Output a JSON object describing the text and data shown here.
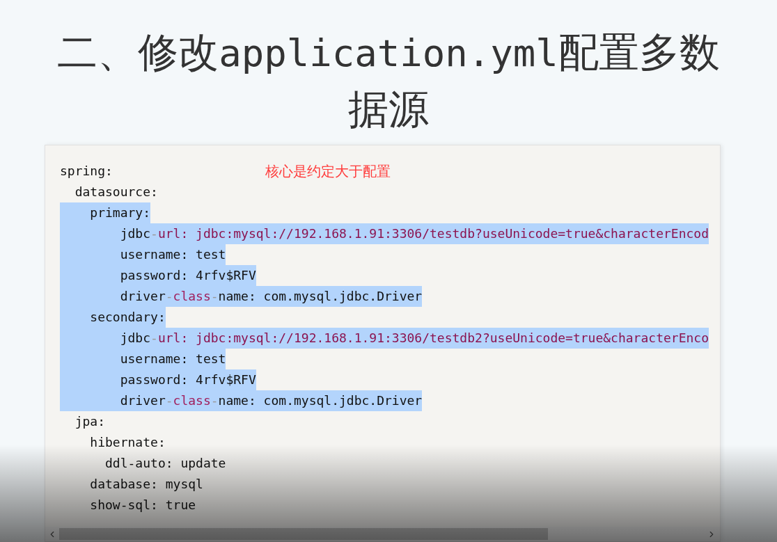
{
  "title": {
    "parts": [
      {
        "kind": "text",
        "text": "二、修改"
      },
      {
        "kind": "code",
        "text": "application.yml"
      },
      {
        "kind": "text",
        "text": "配置多数据源"
      }
    ]
  },
  "code_block": {
    "note": "核心是约定大于配置",
    "lines": [
      {
        "selected": false,
        "tokens": [
          {
            "kind": "plain",
            "text": "spring:"
          }
        ]
      },
      {
        "selected": false,
        "tokens": [
          {
            "kind": "plain",
            "text": "  datasource:"
          }
        ]
      },
      {
        "selected": true,
        "tokens": [
          {
            "kind": "plain",
            "text": "    primary:"
          }
        ]
      },
      {
        "selected": true,
        "tokens": [
          {
            "kind": "plain",
            "text": "        jdbc"
          },
          {
            "kind": "dash",
            "text": "-"
          },
          {
            "kind": "string",
            "text": "url: jdbc:mysql://192.168.1.91:3306/testdb?useUnicode=true&characterEncod"
          }
        ]
      },
      {
        "selected": true,
        "tokens": [
          {
            "kind": "plain",
            "text": "        username: test"
          }
        ]
      },
      {
        "selected": true,
        "tokens": [
          {
            "kind": "plain",
            "text": "        password: 4rfv$RFV"
          }
        ]
      },
      {
        "selected": true,
        "tokens": [
          {
            "kind": "plain",
            "text": "        driver"
          },
          {
            "kind": "dash",
            "text": "-"
          },
          {
            "kind": "keyword",
            "text": "class"
          },
          {
            "kind": "dash",
            "text": "-"
          },
          {
            "kind": "plain",
            "text": "name: com.mysql.jdbc.Driver"
          }
        ]
      },
      {
        "selected": true,
        "tokens": [
          {
            "kind": "plain",
            "text": "    secondary:"
          }
        ]
      },
      {
        "selected": true,
        "tokens": [
          {
            "kind": "plain",
            "text": "        jdbc"
          },
          {
            "kind": "dash",
            "text": "-"
          },
          {
            "kind": "string",
            "text": "url: jdbc:mysql://192.168.1.91:3306/testdb2?useUnicode=true&characterEnco"
          }
        ]
      },
      {
        "selected": true,
        "tokens": [
          {
            "kind": "plain",
            "text": "        username: test"
          }
        ]
      },
      {
        "selected": true,
        "tokens": [
          {
            "kind": "plain",
            "text": "        password: 4rfv$RFV"
          }
        ]
      },
      {
        "selected": true,
        "tokens": [
          {
            "kind": "plain",
            "text": "        driver"
          },
          {
            "kind": "dash",
            "text": "-"
          },
          {
            "kind": "keyword",
            "text": "class"
          },
          {
            "kind": "dash",
            "text": "-"
          },
          {
            "kind": "plain",
            "text": "name: com.mysql.jdbc.Driver"
          }
        ]
      },
      {
        "selected": false,
        "tokens": [
          {
            "kind": "plain",
            "text": "  jpa:"
          }
        ]
      },
      {
        "selected": false,
        "tokens": [
          {
            "kind": "plain",
            "text": "    hibernate:"
          }
        ]
      },
      {
        "selected": false,
        "tokens": [
          {
            "kind": "plain",
            "text": "      ddl-auto: update"
          }
        ]
      },
      {
        "selected": false,
        "tokens": [
          {
            "kind": "plain",
            "text": "    database: mysql"
          }
        ]
      },
      {
        "selected": false,
        "tokens": [
          {
            "kind": "plain",
            "text": "    show-sql: true"
          }
        ]
      }
    ]
  }
}
